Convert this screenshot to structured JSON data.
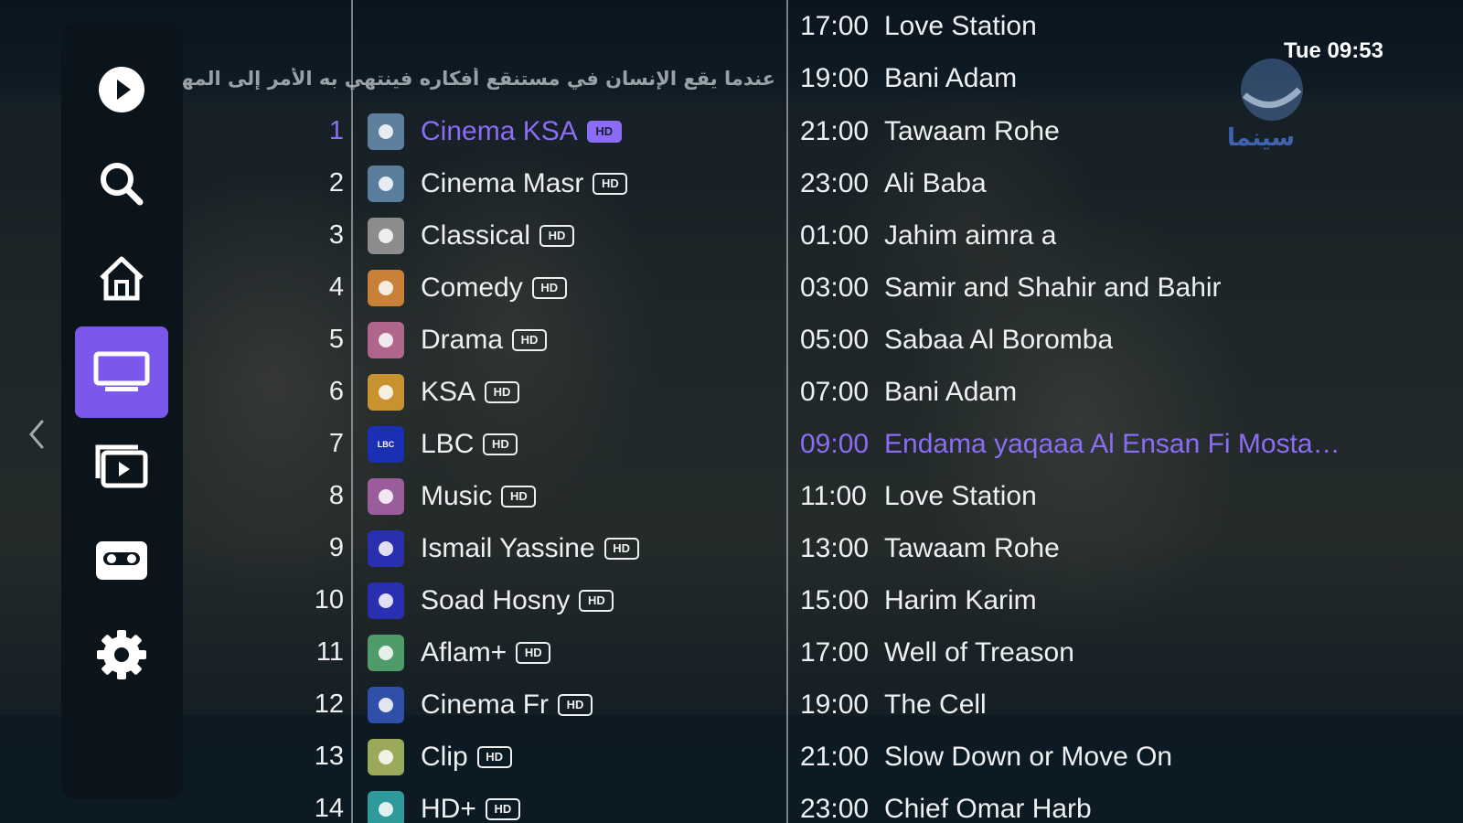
{
  "clock": "Tue 09:53",
  "ticker_text": "عندما يقع الإنسان في مستنقع أفكاره فينتهي به الأمر إلى المهزلة",
  "watermark_text": "سينما",
  "sidebar": {
    "items": [
      {
        "name": "play",
        "icon": "play-icon"
      },
      {
        "name": "search",
        "icon": "search-icon"
      },
      {
        "name": "home",
        "icon": "home-icon"
      },
      {
        "name": "live-tv",
        "icon": "tv-icon",
        "active": true
      },
      {
        "name": "media",
        "icon": "media-icon"
      },
      {
        "name": "recordings",
        "icon": "recording-icon"
      },
      {
        "name": "settings",
        "icon": "gear-icon"
      }
    ]
  },
  "channels": [
    {
      "number": "1",
      "name": "Cinema KSA",
      "hd": "HD",
      "logo_color": "#5f7f9f",
      "selected": true
    },
    {
      "number": "2",
      "name": "Cinema Masr",
      "hd": "HD",
      "logo_color": "#5a7d9e"
    },
    {
      "number": "3",
      "name": "Classical",
      "hd": "HD",
      "logo_color": "#8c8c8c"
    },
    {
      "number": "4",
      "name": "Comedy",
      "hd": "HD",
      "logo_color": "#c9813a"
    },
    {
      "number": "5",
      "name": "Drama",
      "hd": "HD",
      "logo_color": "#b0668c"
    },
    {
      "number": "6",
      "name": "KSA",
      "hd": "HD",
      "logo_color": "#c8922e"
    },
    {
      "number": "7",
      "name": "LBC",
      "hd": "HD",
      "logo_color": "#1b2fb5",
      "logo_text": "LBC"
    },
    {
      "number": "8",
      "name": "Music",
      "hd": "HD",
      "logo_color": "#9b5c9b"
    },
    {
      "number": "9",
      "name": "Ismail Yassine",
      "hd": "HD",
      "logo_color": "#2a2fb0"
    },
    {
      "number": "10",
      "name": "Soad Hosny",
      "hd": "HD",
      "logo_color": "#2a2fb0"
    },
    {
      "number": "11",
      "name": "Aflam+",
      "hd": "HD",
      "logo_color": "#4f9b6a"
    },
    {
      "number": "12",
      "name": "Cinema Fr",
      "hd": "HD",
      "logo_color": "#2f4fa8"
    },
    {
      "number": "13",
      "name": "Clip",
      "hd": "HD",
      "logo_color": "#9aa95a"
    },
    {
      "number": "14",
      "name": "HD+",
      "hd": "HD",
      "logo_color": "#2f9a9a"
    }
  ],
  "schedule": [
    {
      "time": "17:00",
      "title": "Love Station"
    },
    {
      "time": "19:00",
      "title": "Bani Adam"
    },
    {
      "time": "21:00",
      "title": "Tawaam Rohe"
    },
    {
      "time": "23:00",
      "title": "Ali Baba"
    },
    {
      "time": "01:00",
      "title": "Jahim aimra a"
    },
    {
      "time": "03:00",
      "title": "Samir and Shahir and Bahir"
    },
    {
      "time": "05:00",
      "title": "Sabaa Al Boromba"
    },
    {
      "time": "07:00",
      "title": "Bani Adam"
    },
    {
      "time": "09:00",
      "title": "Endama yaqaaa Al Ensan Fi Mosta…",
      "current": true
    },
    {
      "time": "11:00",
      "title": "Love Station"
    },
    {
      "time": "13:00",
      "title": "Tawaam Rohe"
    },
    {
      "time": "15:00",
      "title": "Harim Karim"
    },
    {
      "time": "17:00",
      "title": "Well of Treason"
    },
    {
      "time": "19:00",
      "title": "The Cell"
    },
    {
      "time": "21:00",
      "title": "Slow Down or Move On"
    },
    {
      "time": "23:00",
      "title": "Chief Omar Harb"
    }
  ],
  "colors": {
    "accent": "#7b58ea",
    "selected_text": "#8b6cf5",
    "sidebar_bg": "#0c141b"
  }
}
